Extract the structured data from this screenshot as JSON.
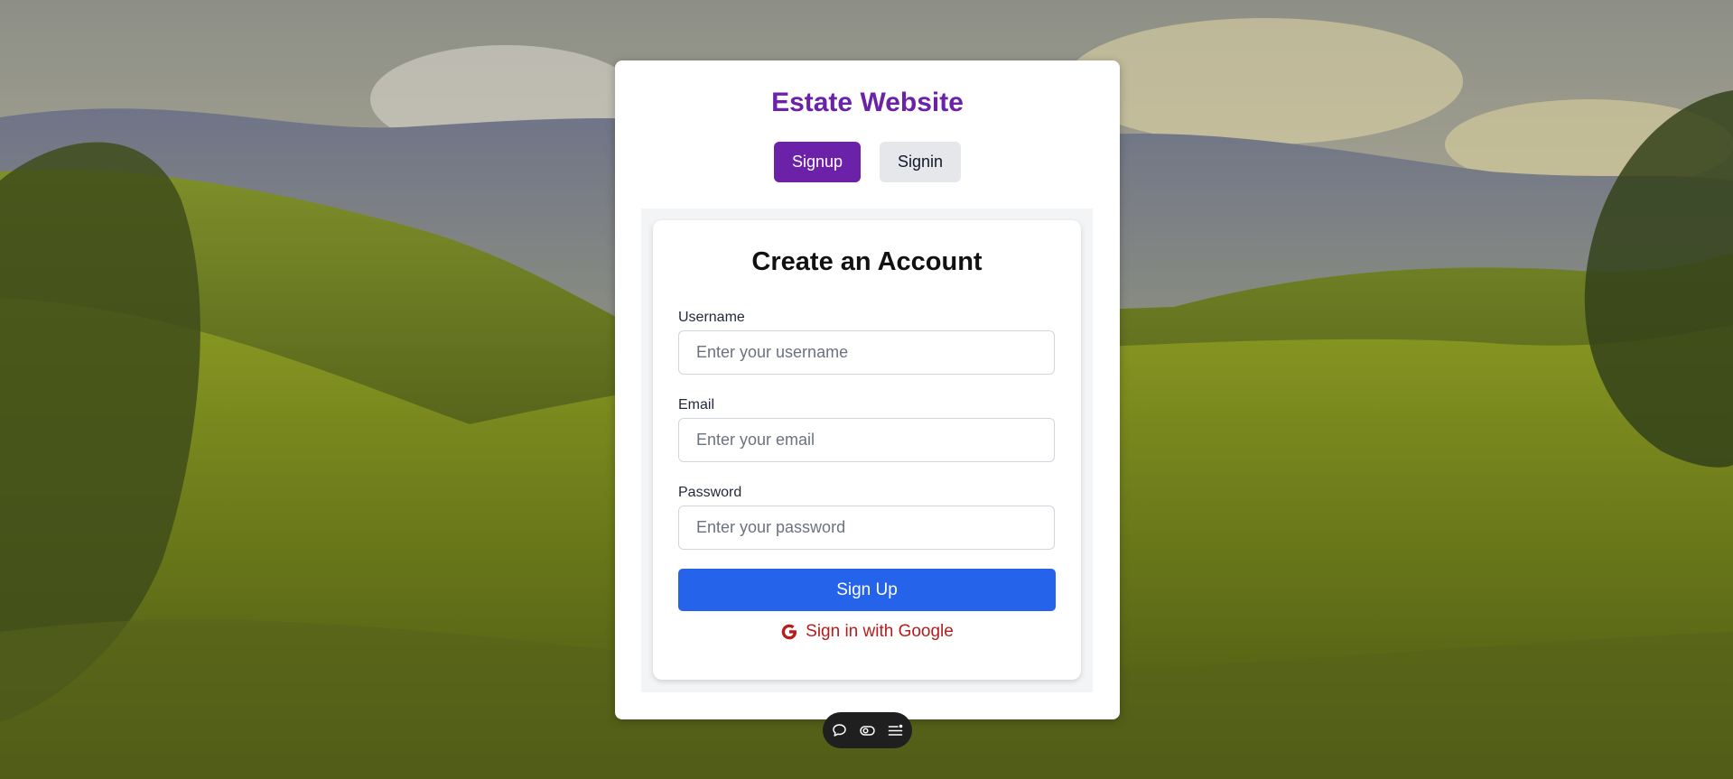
{
  "app": {
    "title": "Estate Website"
  },
  "tabs": [
    {
      "label": "Signup",
      "active": true
    },
    {
      "label": "Signin",
      "active": false
    }
  ],
  "form": {
    "heading": "Create an Account",
    "fields": {
      "username": {
        "label": "Username",
        "placeholder": "Enter your username",
        "value": ""
      },
      "email": {
        "label": "Email",
        "placeholder": "Enter your email",
        "value": ""
      },
      "password": {
        "label": "Password",
        "placeholder": "Enter your password",
        "value": ""
      }
    },
    "submit_label": "Sign Up",
    "google_label": "Sign in with Google"
  },
  "toolbar": {
    "icons": [
      "comment-icon",
      "toggle-icon",
      "menu-icon"
    ]
  },
  "colors": {
    "brand": "#6b21a8",
    "primary_button": "#2563eb",
    "google": "#b91c1c",
    "inactive_tab": "#e5e7eb"
  }
}
